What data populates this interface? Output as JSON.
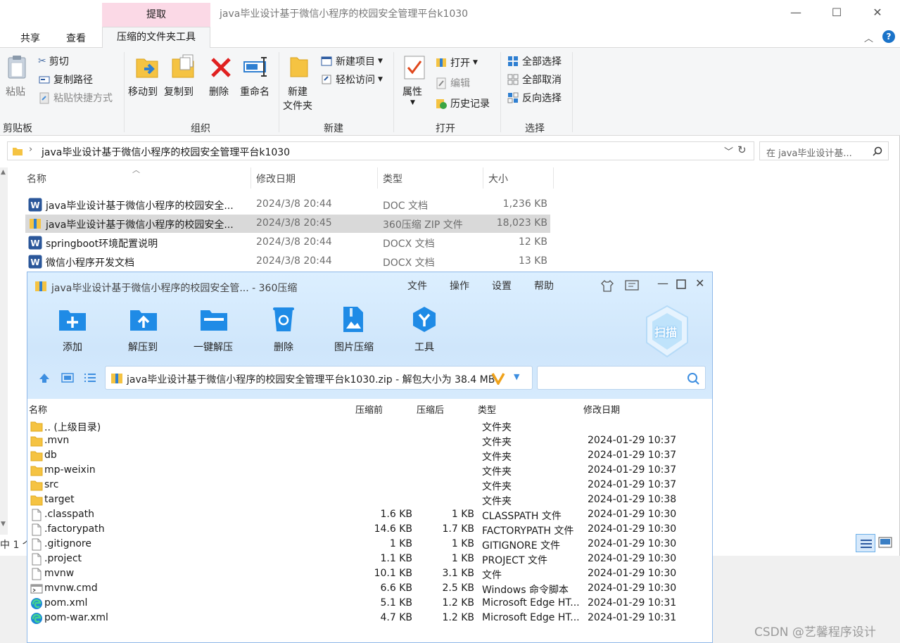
{
  "explorer": {
    "context_tab_header": "提取",
    "window_title": "java毕业设计基于微信小程序的校园安全管理平台k1030",
    "controls": {
      "minimize": "—",
      "maximize": "☐",
      "close": "✕"
    },
    "tabs": {
      "share": "共享",
      "view": "查看",
      "active": "压缩的文件夹工具"
    },
    "ribbon": {
      "clipboard": {
        "paste": "粘贴",
        "cut": "剪切",
        "copy_path": "复制路径",
        "paste_shortcut": "粘贴快捷方式",
        "group": "剪贴板"
      },
      "organize": {
        "move_to": "移动到",
        "copy_to": "复制到",
        "delete": "删除",
        "rename": "重命名",
        "group": "组织"
      },
      "new": {
        "new_folder_line1": "新建",
        "new_folder_line2": "文件夹",
        "new_item": "新建项目",
        "easy_access": "轻松访问",
        "group": "新建"
      },
      "open": {
        "properties": "属性",
        "open": "打开",
        "edit": "编辑",
        "history": "历史记录",
        "group": "打开"
      },
      "select": {
        "select_all": "全部选择",
        "select_none": "全部取消",
        "invert": "反向选择",
        "group": "选择"
      }
    },
    "address": "java毕业设计基于微信小程序的校园安全管理平台k1030",
    "search_placeholder": "在 java毕业设计基...",
    "columns": {
      "name": "名称",
      "date": "修改日期",
      "type": "类型",
      "size": "大小"
    },
    "files": [
      {
        "name": "java毕业设计基于微信小程序的校园安全...",
        "date": "2024/3/8 20:44",
        "type": "DOC 文档",
        "size": "1,236 KB",
        "icon": "word-icon"
      },
      {
        "name": "java毕业设计基于微信小程序的校园安全...",
        "date": "2024/3/8 20:45",
        "type": "360压缩 ZIP 文件",
        "size": "18,023 KB",
        "icon": "zip-icon"
      },
      {
        "name": "springboot环境配置说明",
        "date": "2024/3/8 20:44",
        "type": "DOCX 文档",
        "size": "12 KB",
        "icon": "word-icon"
      },
      {
        "name": "微信小程序开发文档",
        "date": "2024/3/8 20:44",
        "type": "DOCX 文档",
        "size": "13 KB",
        "icon": "word-icon"
      }
    ],
    "status_count": "中 1 个"
  },
  "zip": {
    "title": "java毕业设计基于微信小程序的校园安全管... - 360压缩",
    "menu": [
      "文件",
      "操作",
      "设置",
      "帮助"
    ],
    "tools": [
      "添加",
      "解压到",
      "一键解压",
      "删除",
      "图片压缩",
      "工具"
    ],
    "scan": "扫描",
    "address": "java毕业设计基于微信小程序的校园安全管理平台k1030.zip - 解包大小为 38.4 MB",
    "columns": {
      "name": "名称",
      "before": "压缩前",
      "after": "压缩后",
      "type": "类型",
      "date": "修改日期"
    },
    "rows": [
      {
        "name": ".. (上级目录)",
        "before": "",
        "after": "",
        "type": "文件夹",
        "date": "",
        "icon": "folder-icon"
      },
      {
        "name": ".mvn",
        "before": "",
        "after": "",
        "type": "文件夹",
        "date": "2024-01-29 10:37",
        "icon": "folder-icon"
      },
      {
        "name": "db",
        "before": "",
        "after": "",
        "type": "文件夹",
        "date": "2024-01-29 10:37",
        "icon": "folder-icon"
      },
      {
        "name": "mp-weixin",
        "before": "",
        "after": "",
        "type": "文件夹",
        "date": "2024-01-29 10:37",
        "icon": "folder-icon"
      },
      {
        "name": "src",
        "before": "",
        "after": "",
        "type": "文件夹",
        "date": "2024-01-29 10:37",
        "icon": "folder-icon"
      },
      {
        "name": "target",
        "before": "",
        "after": "",
        "type": "文件夹",
        "date": "2024-01-29 10:38",
        "icon": "folder-icon"
      },
      {
        "name": ".classpath",
        "before": "1.6 KB",
        "after": "1 KB",
        "type": "CLASSPATH 文件",
        "date": "2024-01-29 10:30",
        "icon": "file-icon"
      },
      {
        "name": ".factorypath",
        "before": "14.6 KB",
        "after": "1.7 KB",
        "type": "FACTORYPATH 文件",
        "date": "2024-01-29 10:30",
        "icon": "file-icon"
      },
      {
        "name": ".gitignore",
        "before": "1 KB",
        "after": "1 KB",
        "type": "GITIGNORE 文件",
        "date": "2024-01-29 10:30",
        "icon": "file-icon"
      },
      {
        "name": ".project",
        "before": "1.1 KB",
        "after": "1 KB",
        "type": "PROJECT 文件",
        "date": "2024-01-29 10:30",
        "icon": "file-icon"
      },
      {
        "name": "mvnw",
        "before": "10.1 KB",
        "after": "3.1 KB",
        "type": "文件",
        "date": "2024-01-29 10:30",
        "icon": "file-icon"
      },
      {
        "name": "mvnw.cmd",
        "before": "6.6 KB",
        "after": "2.5 KB",
        "type": "Windows 命令脚本",
        "date": "2024-01-29 10:30",
        "icon": "cmd-icon"
      },
      {
        "name": "pom.xml",
        "before": "5.1 KB",
        "after": "1.2 KB",
        "type": "Microsoft Edge HT...",
        "date": "2024-01-29 10:31",
        "icon": "edge-icon"
      },
      {
        "name": "pom-war.xml",
        "before": "4.7 KB",
        "after": "1.2 KB",
        "type": "Microsoft Edge HT...",
        "date": "2024-01-29 10:31",
        "icon": "edge-icon"
      }
    ]
  },
  "watermark": "CSDN @艺馨程序设计"
}
